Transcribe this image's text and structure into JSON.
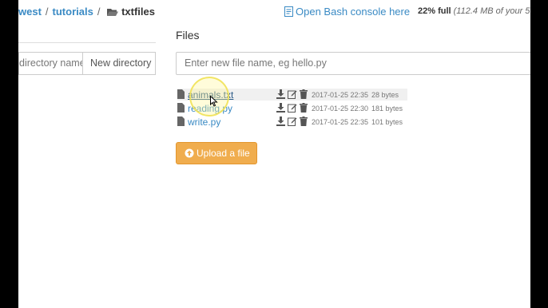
{
  "breadcrumb": {
    "items": [
      "west",
      "tutorials",
      "txtfiles"
    ],
    "separator": "/"
  },
  "header": {
    "console_link": "Open Bash console here",
    "quota_bold": "22% full",
    "quota_detail": "(112.4 MB of your 5"
  },
  "directories": {
    "heading_partial": "",
    "input_placeholder": "directory name",
    "button_label": "New directory"
  },
  "files": {
    "heading": "Files",
    "input_placeholder": "Enter new file name, eg hello.py",
    "items": [
      {
        "name": "animals.txt",
        "date": "2017-01-25 22:35",
        "size": "28 bytes"
      },
      {
        "name": "reading.py",
        "date": "2017-01-25 22:30",
        "size": "181 bytes"
      },
      {
        "name": "write.py",
        "date": "2017-01-25 22:35",
        "size": "101 bytes"
      }
    ],
    "upload_label": "Upload a file"
  },
  "icons": {
    "file": "file-icon",
    "download": "download-icon",
    "edit": "edit-icon",
    "delete": "trash-icon",
    "folder": "folder-open-icon",
    "console": "console-icon",
    "upload": "upload-icon"
  },
  "colors": {
    "link": "#3a8ac4",
    "upload_button": "#f0ad4e"
  }
}
